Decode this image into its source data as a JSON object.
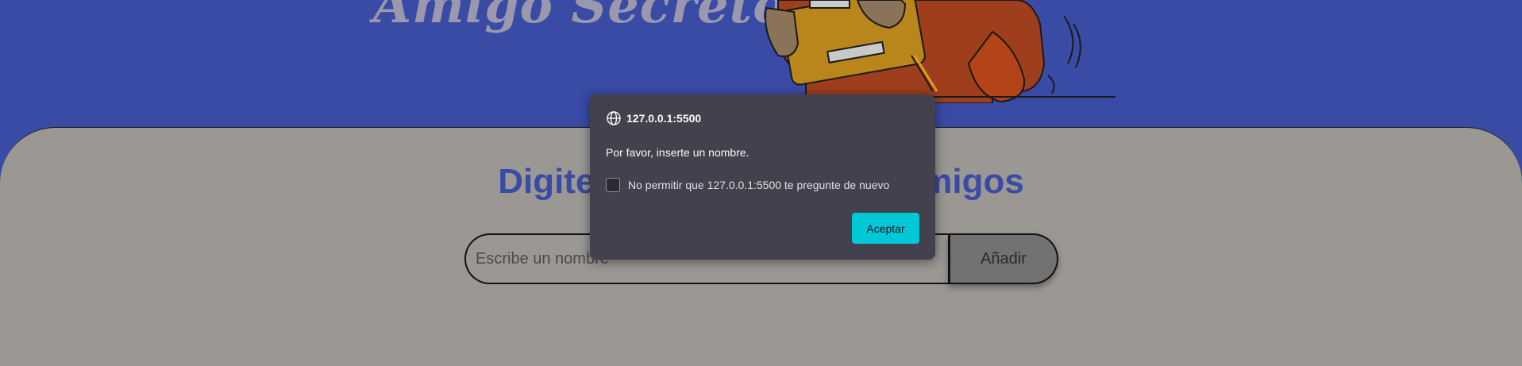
{
  "header": {
    "title": "Amigo Secreto"
  },
  "main": {
    "heading": "Digite el nombre de sus amigos",
    "input_placeholder": "Escribe un nombre",
    "add_button_label": "Añadir"
  },
  "dialog": {
    "origin": "127.0.0.1:5500",
    "message": "Por favor, inserte un nombre.",
    "checkbox_label": "No permitir que 127.0.0.1:5500 te pregunte de nuevo",
    "checkbox_checked": false,
    "accept_label": "Aceptar"
  },
  "colors": {
    "header_bg": "#3a4ba6",
    "panel_bg": "#9b9894",
    "dialog_bg": "#42414d",
    "accept_bg": "#00c8d7",
    "heading": "#3a4ba6"
  },
  "icons": [
    "globe-icon"
  ]
}
